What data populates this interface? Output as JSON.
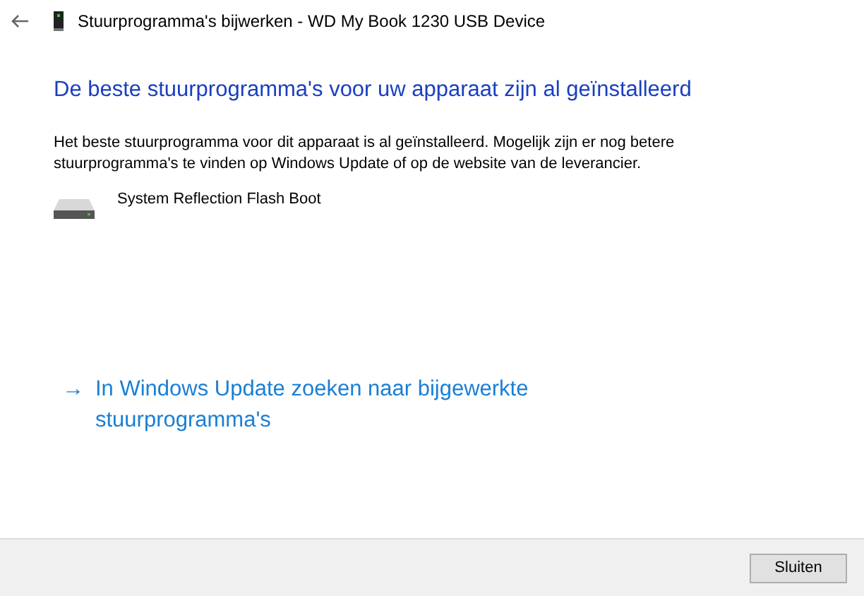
{
  "window": {
    "title": "Stuurprogramma's bijwerken - WD My Book 1230 USB Device"
  },
  "heading": "De beste stuurprogramma's voor uw apparaat zijn al geïnstalleerd",
  "message": "Het beste stuurprogramma voor dit apparaat is al geïnstalleerd. Mogelijk zijn er nog betere stuurprogramma's te vinden op Windows Update of op de website van de leverancier.",
  "device": {
    "name": "System Reflection Flash Boot"
  },
  "link": {
    "arrow": "→",
    "text": "In Windows Update zoeken naar bijgewerkte stuurprogramma's"
  },
  "buttons": [
    "Sluiten"
  ]
}
